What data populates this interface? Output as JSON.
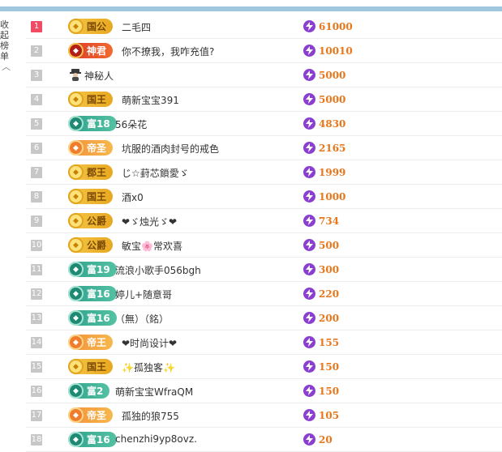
{
  "sidebar": {
    "line1": "收起",
    "line2": "榜单",
    "chevron": "chevron-up-icon"
  },
  "colors": {
    "amount": "#e8761a",
    "rank_top": "#f04a64",
    "rank_default": "#c7c7c7",
    "bolt": "#8a3fd1"
  },
  "rows": [
    {
      "rank": "1",
      "badge": "国公",
      "style": "gold",
      "name": "二毛四",
      "amount": "61000"
    },
    {
      "rank": "2",
      "badge": "神君",
      "style": "red",
      "name": "你不撩我，我咋充值?",
      "amount": "10010"
    },
    {
      "rank": "3",
      "badge": "",
      "style": "mystery",
      "name": "神秘人",
      "amount": "5000"
    },
    {
      "rank": "4",
      "badge": "国王",
      "style": "gold",
      "name": "萌新宝宝391",
      "amount": "5000"
    },
    {
      "rank": "5",
      "badge": "富18",
      "style": "teal",
      "name": "56朵花",
      "amount": "4830"
    },
    {
      "rank": "6",
      "badge": "帝圣",
      "style": "orange",
      "name": "坑服的酒肉封号的戒色",
      "amount": "2165"
    },
    {
      "rank": "7",
      "badge": "郡王",
      "style": "gold",
      "name": "じ☆葑芯鎖愛ゞ",
      "amount": "1999"
    },
    {
      "rank": "8",
      "badge": "国王",
      "style": "gold",
      "name": "酒x0",
      "amount": "1000"
    },
    {
      "rank": "9",
      "badge": "公爵",
      "style": "gold",
      "name": "❤ゞ烛光ゞ❤",
      "amount": "734"
    },
    {
      "rank": "10",
      "badge": "公爵",
      "style": "gold",
      "name": "敏宝🌸常欢喜",
      "amount": "500"
    },
    {
      "rank": "11",
      "badge": "富19",
      "style": "teal",
      "name": "流浪小歌手056bgh",
      "amount": "300"
    },
    {
      "rank": "12",
      "badge": "富16",
      "style": "teal",
      "name": "婷儿+随意哥",
      "amount": "220"
    },
    {
      "rank": "13",
      "badge": "富16",
      "style": "teal",
      "name": "（無）（銘）",
      "amount": "200"
    },
    {
      "rank": "14",
      "badge": "帝王",
      "style": "orange",
      "name": "❤时尚设计❤",
      "amount": "155"
    },
    {
      "rank": "15",
      "badge": "国王",
      "style": "gold",
      "name": "✨孤独客✨",
      "amount": "150"
    },
    {
      "rank": "16",
      "badge": "富2",
      "style": "teal",
      "name": "萌新宝宝WfraQM",
      "amount": "150"
    },
    {
      "rank": "17",
      "badge": "帝圣",
      "style": "orange",
      "name": "孤独的狼755",
      "amount": "105"
    },
    {
      "rank": "18",
      "badge": "富16",
      "style": "teal",
      "name": "chenzhi9yp8ovz.",
      "amount": "20"
    }
  ]
}
